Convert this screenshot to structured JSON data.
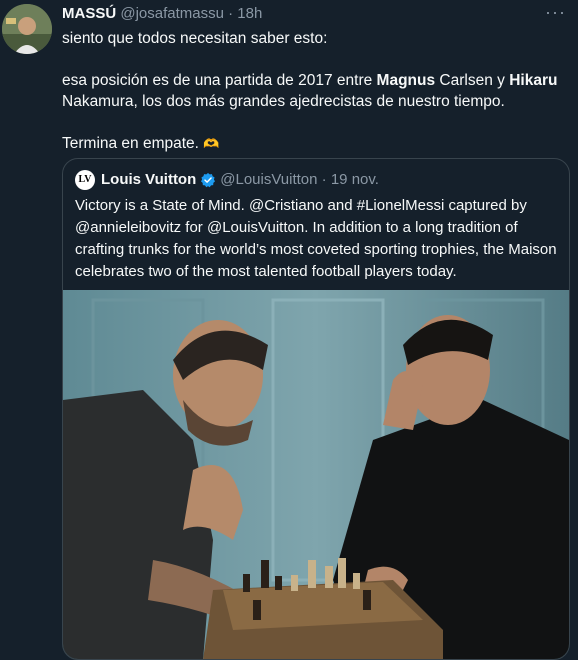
{
  "author": {
    "name": "MASSÚ",
    "handle": "@josafatmassu",
    "dot": "·",
    "time": "18h"
  },
  "more_label": "···",
  "tweet": {
    "line1": "siento que todos necesitan saber esto:",
    "line2_a": "esa posición es de una partida de 2017 entre ",
    "line2_b": "Magnus",
    "line2_c": " Carlsen y ",
    "line2_d": "Hikaru",
    "line2_e": " Nakamura, los dos más grandes ajedrecistas de nuestro tiempo.",
    "line3": "Termina en empate.",
    "emoji": "🫶"
  },
  "quoted": {
    "logo_text": "LV",
    "name": "Louis Vuitton",
    "handle": "@LouisVuitton",
    "dot": "·",
    "time": "19 nov.",
    "text": "Victory is a State of Mind. @Cristiano and #LionelMessi captured by @annieleibovitz for @LouisVuitton. In addition to a long tradition of crafting trunks for the world’s most coveted sporting trophies, the Maison celebrates two of the most talented football players today."
  },
  "colors": {
    "background": "#15202b",
    "secondary_text": "#8b98a5",
    "verified": "#1d9bf0",
    "border": "#38444d"
  }
}
